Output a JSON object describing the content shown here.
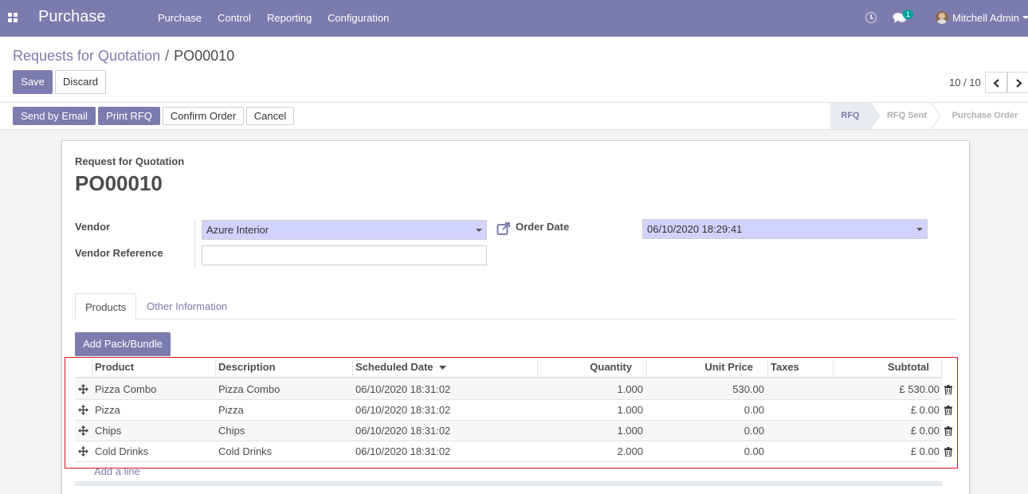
{
  "navbar": {
    "app_title": "Purchase",
    "menu": [
      "Purchase",
      "Control",
      "Reporting",
      "Configuration"
    ],
    "chat_count": "1",
    "user_name": "Mitchell Admin"
  },
  "breadcrumb": {
    "parent": "Requests for Quotation",
    "separator": "/",
    "current": "PO00010"
  },
  "actions": {
    "save": "Save",
    "discard": "Discard"
  },
  "pager": {
    "value": "10 / 10"
  },
  "statusbar": {
    "buttons": [
      "Send by Email",
      "Print RFQ",
      "Confirm Order",
      "Cancel"
    ],
    "steps": [
      "RFQ",
      "RFQ Sent",
      "Purchase Order"
    ],
    "active_step": "RFQ"
  },
  "form": {
    "subtitle": "Request for Quotation",
    "title": "PO00010",
    "vendor_label": "Vendor",
    "vendor_value": "Azure Interior",
    "vendor_reference_label": "Vendor Reference",
    "vendor_reference_value": "",
    "order_date_label": "Order Date",
    "order_date_value": "06/10/2020 18:29:41"
  },
  "tabs": [
    "Products",
    "Other Information"
  ],
  "add_pack_label": "Add Pack/Bundle",
  "lines": {
    "headers": [
      "Product",
      "Description",
      "Scheduled Date",
      "Quantity",
      "Unit Price",
      "Taxes",
      "Subtotal"
    ],
    "rows": [
      {
        "product": "Pizza Combo",
        "description": "Pizza Combo",
        "date": "06/10/2020 18:31:02",
        "qty": "1.000",
        "price": "530.00",
        "taxes": "",
        "subtotal": "£ 530.00"
      },
      {
        "product": "Pizza",
        "description": "Pizza",
        "date": "06/10/2020 18:31:02",
        "qty": "1.000",
        "price": "0.00",
        "taxes": "",
        "subtotal": "£ 0.00"
      },
      {
        "product": "Chips",
        "description": "Chips",
        "date": "06/10/2020 18:31:02",
        "qty": "1.000",
        "price": "0.00",
        "taxes": "",
        "subtotal": "£ 0.00"
      },
      {
        "product": "Cold Drinks",
        "description": "Cold Drinks",
        "date": "06/10/2020 18:31:02",
        "qty": "2.000",
        "price": "0.00",
        "taxes": "",
        "subtotal": "£ 0.00"
      }
    ],
    "add_line": "Add a line"
  },
  "colors": {
    "brand": "#7c7bad",
    "required_field": "#d2d2ff",
    "highlight": "#d0141a"
  }
}
